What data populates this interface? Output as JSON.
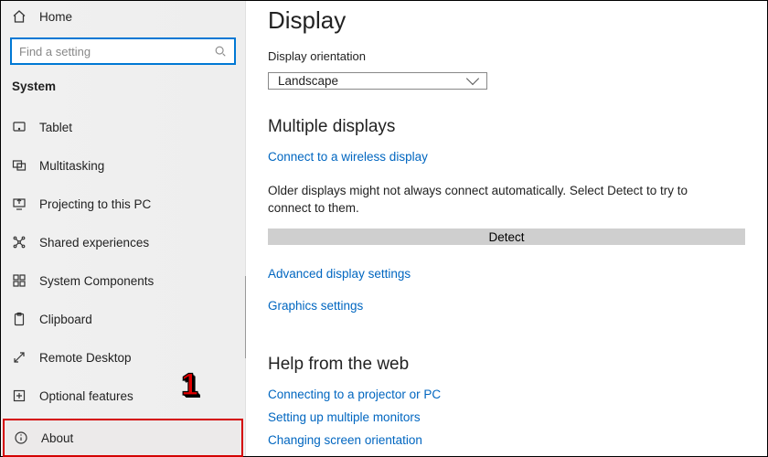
{
  "sidebar": {
    "home_label": "Home",
    "search_placeholder": "Find a setting",
    "section_label": "System",
    "items": [
      {
        "label": "Tablet",
        "icon": "tablet-icon"
      },
      {
        "label": "Multitasking",
        "icon": "multitasking-icon"
      },
      {
        "label": "Projecting to this PC",
        "icon": "projecting-icon"
      },
      {
        "label": "Shared experiences",
        "icon": "shared-icon"
      },
      {
        "label": "System Components",
        "icon": "components-icon"
      },
      {
        "label": "Clipboard",
        "icon": "clipboard-icon"
      },
      {
        "label": "Remote Desktop",
        "icon": "remote-desktop-icon"
      },
      {
        "label": "Optional features",
        "icon": "optional-features-icon"
      },
      {
        "label": "About",
        "icon": "about-icon"
      }
    ]
  },
  "callout": {
    "number": "1"
  },
  "main": {
    "page_title": "Display",
    "orientation": {
      "label": "Display orientation",
      "value": "Landscape"
    },
    "multiple_displays": {
      "heading": "Multiple displays",
      "connect_link": "Connect to a wireless display",
      "info": "Older displays might not always connect automatically. Select Detect to try to connect to them.",
      "detect_button": "Detect",
      "advanced_link": "Advanced display settings",
      "graphics_link": "Graphics settings"
    },
    "help": {
      "heading": "Help from the web",
      "links": [
        "Connecting to a projector or PC",
        "Setting up multiple monitors",
        "Changing screen orientation"
      ]
    }
  }
}
